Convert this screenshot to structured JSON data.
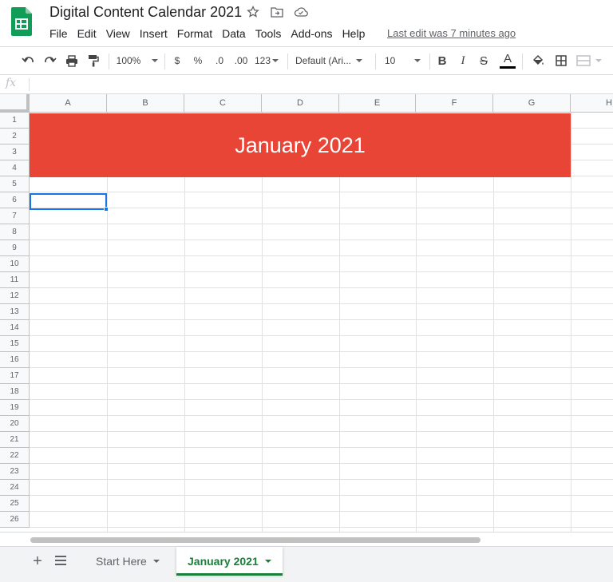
{
  "app": {
    "title": "Digital Content Calendar 2021",
    "menu": [
      "File",
      "Edit",
      "View",
      "Insert",
      "Format",
      "Data",
      "Tools",
      "Add-ons",
      "Help"
    ],
    "last_edit": "Last edit was 7 minutes ago"
  },
  "toolbar": {
    "zoom": "100%",
    "currency": "$",
    "percent": "%",
    "decrease_decimal": ".0",
    "increase_decimal": ".00",
    "more_formats": "123",
    "font": "Default (Ari...",
    "font_size": "10",
    "bold": "B",
    "italic": "I",
    "strikethrough": "S",
    "text_color": "A"
  },
  "formula_bar": {
    "fx_label": "fx",
    "value": ""
  },
  "grid": {
    "columns": [
      "A",
      "B",
      "C",
      "D",
      "E",
      "F",
      "G",
      "H"
    ],
    "rows": [
      "1",
      "2",
      "3",
      "4",
      "5",
      "6",
      "7",
      "8",
      "9",
      "10",
      "11",
      "12",
      "13",
      "14",
      "15",
      "16",
      "17",
      "18",
      "19",
      "20",
      "21",
      "22",
      "23",
      "24",
      "25",
      "26"
    ],
    "banner_text": "January 2021",
    "banner_color": "#e94537",
    "selected_cell": "A6"
  },
  "sheets": {
    "tabs": [
      {
        "label": "Start Here",
        "active": false
      },
      {
        "label": "January 2021",
        "active": true
      }
    ],
    "accent_color": "#188038"
  }
}
